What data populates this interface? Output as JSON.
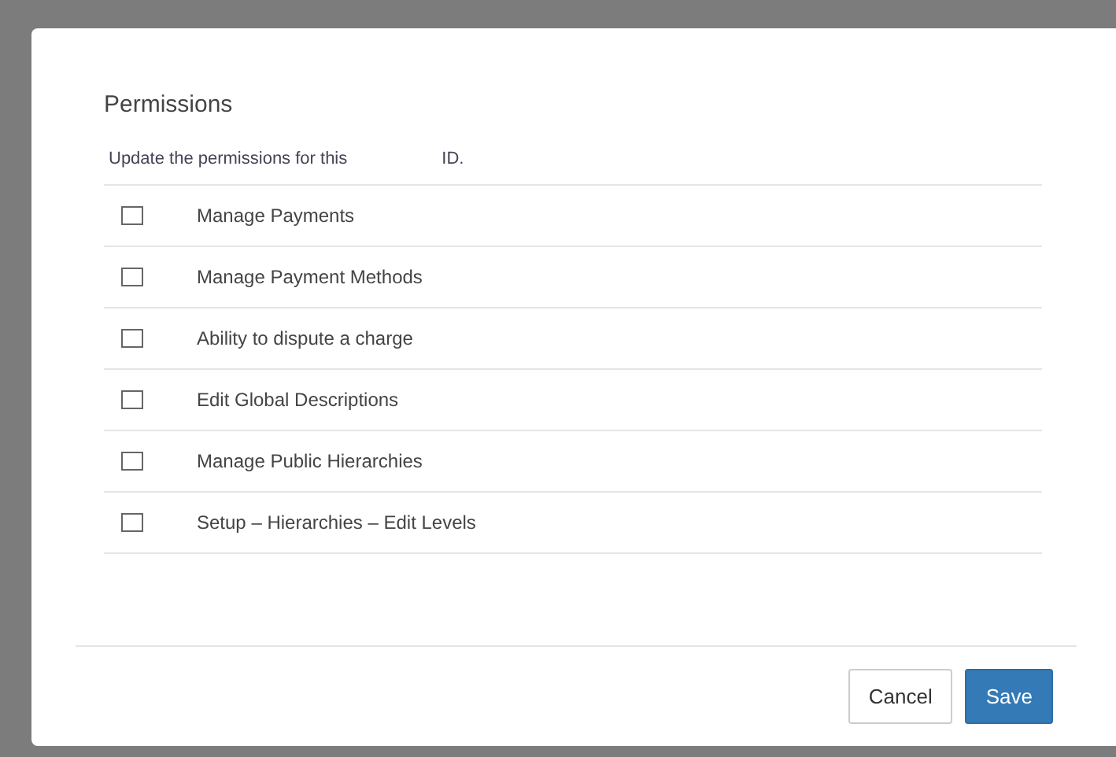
{
  "dialog": {
    "title": "Permissions",
    "intro": "Update the permissions for this",
    "intro_suffix": "ID.",
    "permissions": [
      {
        "label": "Manage Payments",
        "checked": false
      },
      {
        "label": "Manage Payment Methods",
        "checked": false
      },
      {
        "label": "Ability to dispute a charge",
        "checked": false
      },
      {
        "label": "Edit Global Descriptions",
        "checked": false
      },
      {
        "label": "Manage Public Hierarchies",
        "checked": false
      },
      {
        "label": "Setup – Hierarchies – Edit Levels",
        "checked": false
      }
    ],
    "buttons": [
      {
        "label": "Cancel",
        "kind": "secondary"
      },
      {
        "label": "Save",
        "kind": "primary"
      }
    ]
  }
}
